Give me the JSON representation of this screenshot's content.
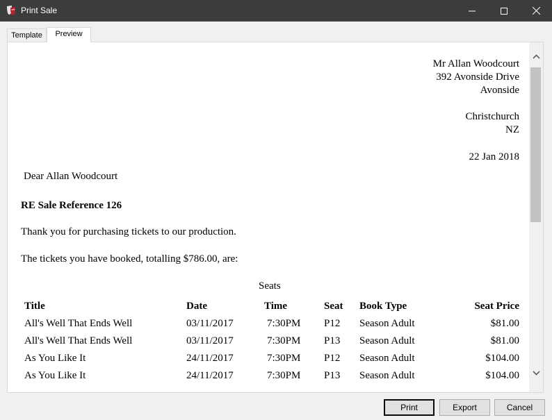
{
  "window": {
    "title": "Print Sale"
  },
  "tabs": [
    {
      "label": "Template"
    },
    {
      "label": "Preview"
    }
  ],
  "letter": {
    "address": [
      "Mr Allan Woodcourt",
      "392 Avonside Drive",
      "Avonside",
      "",
      "Christchurch",
      "NZ"
    ],
    "date": "22 Jan 2018",
    "greeting": "Dear Allan Woodcourt",
    "reference": "RE Sale Reference 126",
    "thanks": "Thank you for purchasing tickets to our production.",
    "summary": "The tickets you have booked, totalling $786.00, are:",
    "table_caption": "Seats",
    "columns": [
      "Title",
      "Date",
      "Time",
      "Seat",
      "Book Type",
      "Seat Price"
    ],
    "rows": [
      [
        "All's Well That Ends Well",
        "03/11/2017",
        "7:30PM",
        "P12",
        "Season Adult",
        "$81.00"
      ],
      [
        "All's Well That Ends Well",
        "03/11/2017",
        "7:30PM",
        "P13",
        "Season Adult",
        "$81.00"
      ],
      [
        "As You Like It",
        "24/11/2017",
        "7:30PM",
        "P12",
        "Season Adult",
        "$104.00"
      ],
      [
        "As You Like It",
        "24/11/2017",
        "7:30PM",
        "P13",
        "Season Adult",
        "$104.00"
      ]
    ]
  },
  "buttons": {
    "print": "Print",
    "export": "Export",
    "cancel": "Cancel"
  },
  "icons": {
    "app": "theatre-masks-icon",
    "minimize": "minimize-icon",
    "maximize": "maximize-icon",
    "close": "close-icon"
  }
}
